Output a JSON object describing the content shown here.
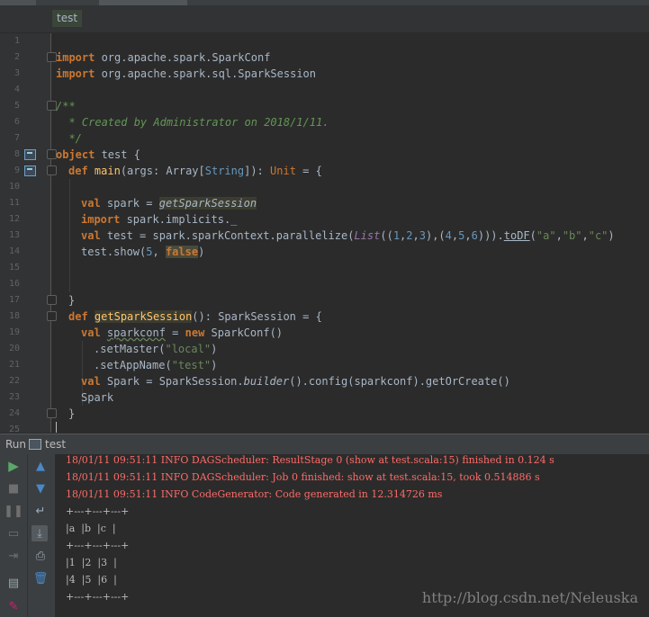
{
  "editor": {
    "breadcrumb": "test",
    "line_numbers": [
      "1",
      "2",
      "3",
      "4",
      "5",
      "6",
      "7",
      "8",
      "9",
      "10",
      "11",
      "12",
      "13",
      "14",
      "15",
      "16",
      "17",
      "18",
      "19",
      "20",
      "21",
      "22",
      "23",
      "24",
      "25"
    ]
  },
  "code": {
    "l2": {
      "kw": "import",
      "rest": " org.apache.spark.SparkConf"
    },
    "l3": {
      "kw": "import",
      "rest": " org.apache.spark.sql.SparkSession"
    },
    "l5": "/**",
    "l6": "  * Created by Administrator on 2018/1/11.",
    "l7": "  */",
    "l8": {
      "kw": "object",
      "rest": " test {"
    },
    "l9": {
      "kw": "def",
      "name": "main",
      "p1": "(args: Array[",
      "typ": "String",
      "p2": "]): ",
      "unit": "Unit",
      "p3": " = {"
    },
    "l11": {
      "kw": "val",
      "rest": " spark = ",
      "call": "getSparkSession"
    },
    "l12": {
      "kw": "import",
      "rest": " spark.implicits._"
    },
    "l13": {
      "kw": "val",
      "a": " test = spark.sparkContext.parallelize(",
      "list": "List",
      "b": "((",
      "n1": "1",
      "c1": ",",
      "n2": "2",
      "c2": ",",
      "n3": "3",
      "c3": "),(",
      "n4": "4",
      "c4": ",",
      "n5": "5",
      "c5": ",",
      "n6": "6",
      "c6": "))).",
      "todf": "toDF",
      "d": "(",
      "s1": "\"a\"",
      "e1": ",",
      "s2": "\"b\"",
      "e2": ",",
      "s3": "\"c\"",
      "f": ")"
    },
    "l14": {
      "a": "test.show(",
      "n": "5",
      "b": ", ",
      "false": "false",
      "c": ")"
    },
    "l17": "}",
    "l18": {
      "kw": "def",
      "name": "getSparkSession",
      "rest": "(): SparkSession = {"
    },
    "l19": {
      "kw": "val",
      "var": "sparkconf",
      "mid": " = ",
      "new": "new",
      "rest": " SparkConf()"
    },
    "l20": {
      "a": ".setMaster(",
      "s": "\"local\"",
      "b": ")"
    },
    "l21": {
      "a": ".setAppName(",
      "s": "\"test\"",
      "b": ")"
    },
    "l22": {
      "kw": "val",
      "a": " Spark = SparkSession.",
      "builder": "builder",
      "b": "().config(sparkconf).getOrCreate()"
    },
    "l23": "Spark",
    "l24": "}"
  },
  "run_panel": {
    "label": "Run",
    "tab": "test"
  },
  "console": {
    "lines": [
      "18/01/11 09:51:11 INFO DAGScheduler: ResultStage 0 (show at test.scala:15) finished in 0.124 s",
      "18/01/11 09:51:11 INFO DAGScheduler: Job 0 finished: show at test.scala:15, took 0.514886 s",
      "18/01/11 09:51:11 INFO CodeGenerator: Code generated in 12.314726 ms",
      "+---+---+---+",
      "|a  |b  |c  |",
      "+---+---+---+",
      "|1  |2  |3  |",
      "|4  |5  |6  |",
      "+---+---+---+"
    ]
  },
  "watermark": "http://blog.csdn.net/Neleuska",
  "colors": {
    "keyword": "#cc7832",
    "function": "#ffc66d",
    "string": "#6a8759",
    "number": "#6897bb",
    "comment": "#629755",
    "error_text": "#ff6b68",
    "run_green": "#59a869",
    "nav_blue": "#4a88c7"
  }
}
